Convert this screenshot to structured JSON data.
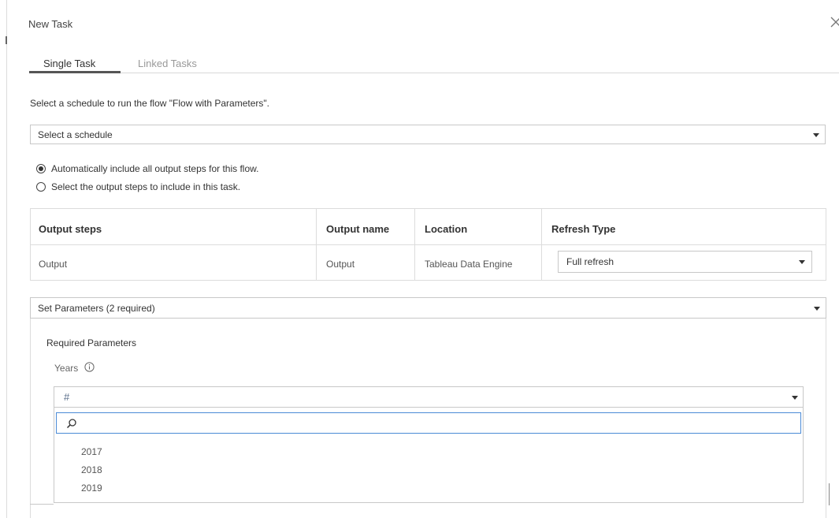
{
  "dialog": {
    "title": "New Task",
    "close_icon": "close-icon"
  },
  "tabs": [
    {
      "label": "Single Task",
      "active": true
    },
    {
      "label": "Linked Tasks",
      "active": false
    }
  ],
  "instruction": "Select a schedule to run the flow \"Flow with Parameters\".",
  "schedule": {
    "value": "Select a schedule"
  },
  "radios": [
    {
      "label": "Automatically include all output steps for this flow.",
      "checked": true
    },
    {
      "label": "Select the output steps to include in this task.",
      "checked": false
    }
  ],
  "output_table": {
    "headers": [
      "Output steps",
      "Output name",
      "Location",
      "Refresh Type"
    ],
    "rows": [
      {
        "step": "Output",
        "name": "Output",
        "location": "Tableau Data Engine",
        "refresh_type": "Full refresh"
      }
    ]
  },
  "parameters": {
    "header": "Set Parameters (2 required)",
    "section_title": "Required Parameters",
    "years_label": "Years",
    "years_value_icon": "#",
    "search_value": "",
    "options": [
      "2017",
      "2018",
      "2019"
    ]
  },
  "colors": {
    "accent_focus": "#4b8bd6",
    "hash_icon": "#5a6e8a"
  }
}
